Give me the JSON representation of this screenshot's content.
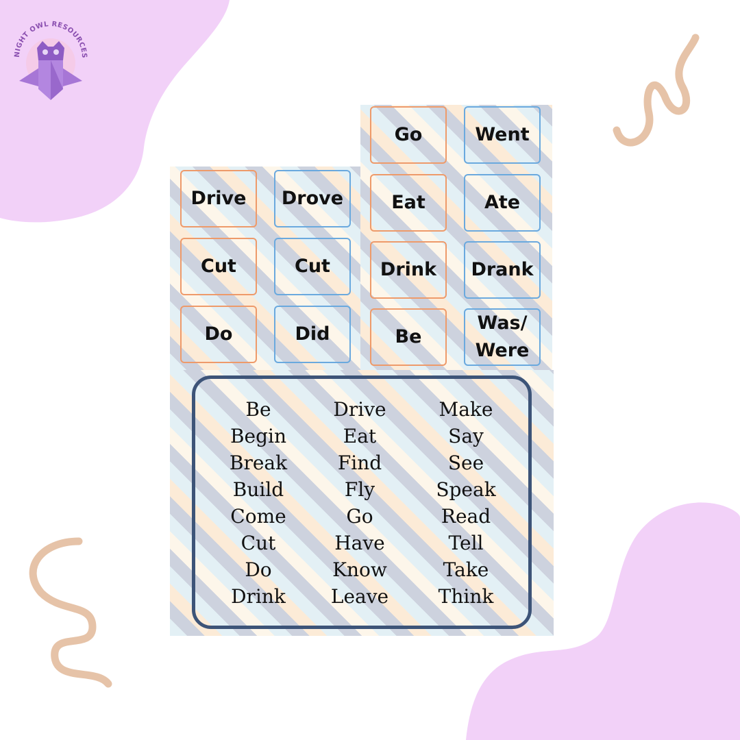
{
  "brand": {
    "logo_text": "NIGHT OWL RESOURCES"
  },
  "colors": {
    "blob": "#f2d1f8",
    "squiggle": "#e6c3a8",
    "present_card_border": "#ee9a6a",
    "past_card_border": "#6aa9de",
    "verb_box_border": "#3d5478"
  },
  "cards_left": [
    {
      "word": "Drive",
      "type": "present"
    },
    {
      "word": "Drove",
      "type": "past"
    },
    {
      "word": "Cut",
      "type": "present"
    },
    {
      "word": "Cut",
      "type": "past"
    },
    {
      "word": "Do",
      "type": "present"
    },
    {
      "word": "Did",
      "type": "past"
    }
  ],
  "cards_right": [
    {
      "word": "Go",
      "type": "present"
    },
    {
      "word": "Went",
      "type": "past"
    },
    {
      "word": "Eat",
      "type": "present"
    },
    {
      "word": "Ate",
      "type": "past"
    },
    {
      "word": "Drink",
      "type": "present"
    },
    {
      "word": "Drank",
      "type": "past"
    },
    {
      "word": "Be",
      "type": "present"
    },
    {
      "word": "Was/ Were",
      "type": "past"
    }
  ],
  "verb_list": {
    "columns": [
      [
        "Be",
        "Begin",
        "Break",
        "Build",
        "Come",
        "Cut",
        "Do",
        "Drink"
      ],
      [
        "Drive",
        "Eat",
        "Find",
        "Fly",
        "Go",
        "Have",
        "Know",
        "Leave"
      ],
      [
        "Make",
        "Say",
        "See",
        "Speak",
        "Read",
        "Tell",
        "Take",
        "Think"
      ]
    ]
  }
}
